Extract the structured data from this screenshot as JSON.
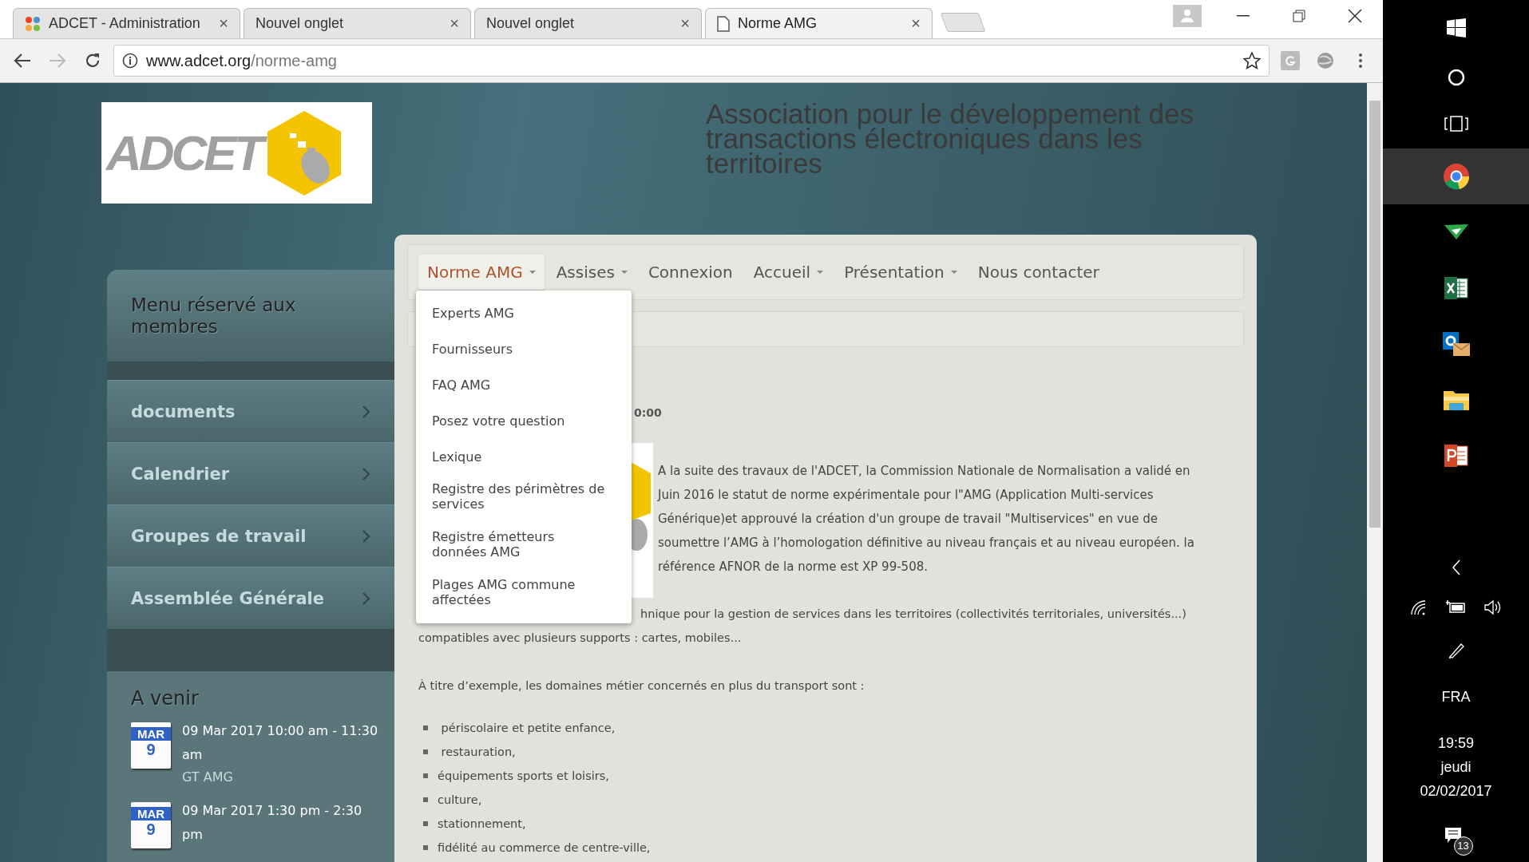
{
  "browser": {
    "tabs": [
      {
        "title": "ADCET - Administration",
        "selected": false,
        "kind": "joomla",
        "close": "×"
      },
      {
        "title": "Nouvel onglet",
        "selected": false,
        "kind": "blank",
        "close": "×"
      },
      {
        "title": "Nouvel onglet",
        "selected": false,
        "kind": "blank",
        "close": "×"
      },
      {
        "title": "Norme AMG",
        "selected": true,
        "kind": "page",
        "close": "×"
      }
    ],
    "address": {
      "host": "www.adcet.org",
      "path": "/norme-amg"
    }
  },
  "header": {
    "logo_text": "ADCET",
    "title": "Association pour le développement des transactions électroniques dans les territoires"
  },
  "sidebar": {
    "menu_title": "Menu réservé aux membres",
    "items": [
      "documents",
      "Calendrier",
      "Groupes de travail",
      "Assemblée Générale"
    ],
    "upcoming": {
      "title": "A venir",
      "events": [
        {
          "month": "MAR",
          "day": "9",
          "when": "09 Mar 2017 10:00 am - 11:30 am",
          "name": "GT AMG"
        },
        {
          "month": "MAR",
          "day": "9",
          "when": "09 Mar 2017 1:30 pm - 2:30 pm"
        }
      ]
    }
  },
  "nav": {
    "items": [
      {
        "label": "Norme AMG",
        "caret": true,
        "selected": true
      },
      {
        "label": "Assises",
        "caret": true,
        "selected": false
      },
      {
        "label": "Connexion",
        "caret": false,
        "selected": false
      },
      {
        "label": "Accueil",
        "caret": true,
        "selected": false
      },
      {
        "label": "Présentation",
        "caret": true,
        "selected": false
      },
      {
        "label": "Nous contacter",
        "caret": false,
        "selected": false
      }
    ],
    "dropdown": [
      "Experts AMG",
      "Fournisseurs",
      "FAQ AMG",
      "Posez votre question",
      "Lexique",
      "Registre des périmètres de services",
      "Registre émetteurs données AMG",
      "Plages AMG commune affectées"
    ]
  },
  "article": {
    "date_fragment": "0:00",
    "intro": "A la suite des travaux de l'ADCET,  la Commission Nationale de Normalisation a validé en Juin 2016 le statut de norme expérimentale pour l\"AMG (Application Multi-services Générique)et approuvé la création d'un groupe de travail \"Multiservices\" en vue de soumettre l’AMG  à l’homologation définitive au niveau français et au niveau européen. la référence AFNOR de la norme est XP 99-508.",
    "fragment": "hnique pour la gestion de services dans les territoires (collectivités territoriales, universités...)  compatibles avec plusieurs supports  : cartes, mobiles...",
    "lead": "À titre d’exemple, les domaines métier concernés en plus du transport sont :",
    "list": [
      " périscolaire et petite enfance,",
      " restauration,",
      "équipements sports et loisirs,",
      "culture,",
      "stationnement,",
      "fidélité au commerce de centre-ville,"
    ]
  },
  "taskbar": {
    "apps": [
      {
        "kind": "chrome",
        "selected": true
      },
      {
        "kind": "plane",
        "selected": false
      },
      {
        "kind": "excel",
        "selected": false
      },
      {
        "kind": "outlook",
        "selected": false
      },
      {
        "kind": "explorer",
        "selected": false
      },
      {
        "kind": "powerpoint",
        "selected": false
      }
    ],
    "language": "FRA",
    "time": "19:59",
    "day": "jeudi",
    "date": "02/02/2017",
    "notifications": "13"
  }
}
